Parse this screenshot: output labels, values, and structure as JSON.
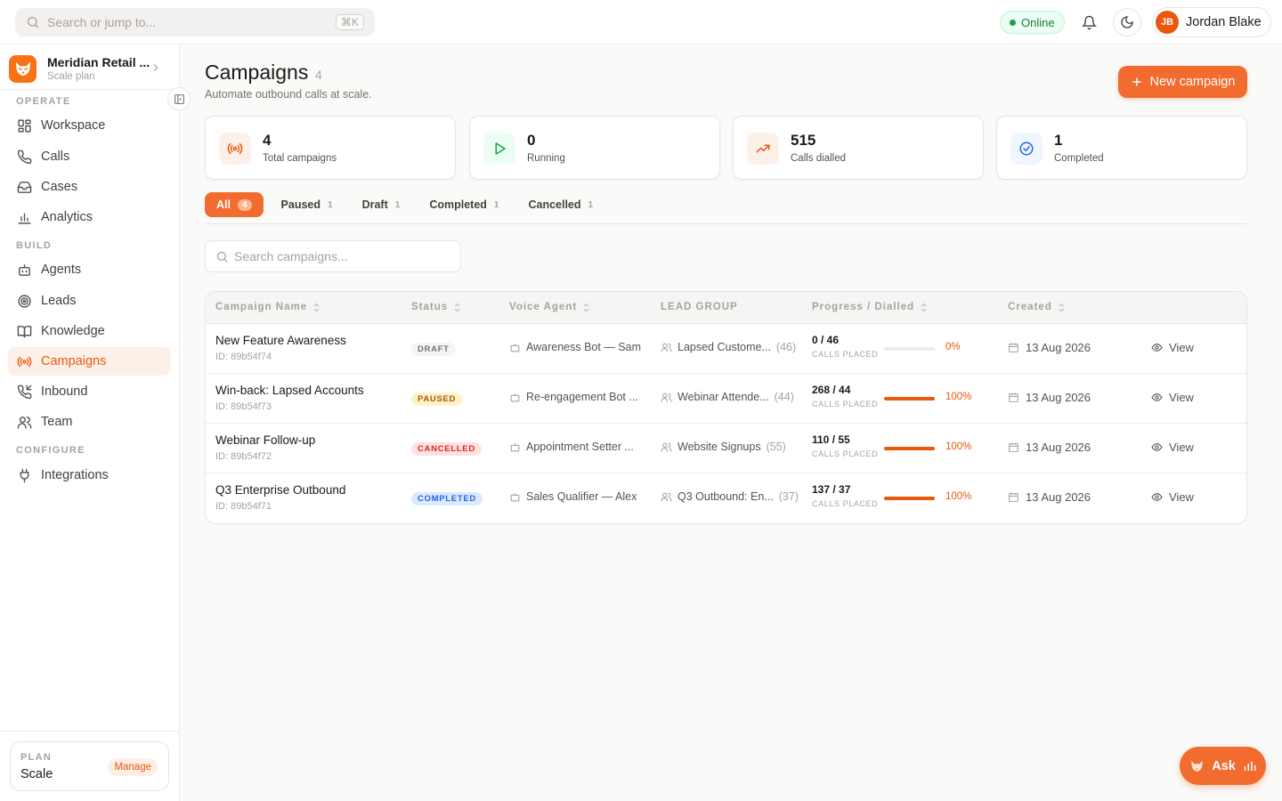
{
  "topbar": {
    "search_placeholder": "Search or jump to...",
    "shortcut": "⌘K",
    "status": "Online",
    "user": {
      "initials": "JB",
      "name": "Jordan Blake"
    }
  },
  "sidebar": {
    "org_name": "Meridian Retail ...",
    "org_plan": "Scale plan",
    "sections": {
      "operate": "OPERATE",
      "build": "BUILD",
      "configure": "CONFIGURE"
    },
    "items": [
      {
        "label": "Workspace",
        "icon": "grid-icon"
      },
      {
        "label": "Calls",
        "icon": "phone-icon"
      },
      {
        "label": "Cases",
        "icon": "inbox-icon"
      },
      {
        "label": "Analytics",
        "icon": "bar-chart-icon"
      },
      {
        "label": "Agents",
        "icon": "bot-icon"
      },
      {
        "label": "Leads",
        "icon": "target-icon"
      },
      {
        "label": "Knowledge",
        "icon": "book-icon"
      },
      {
        "label": "Campaigns",
        "icon": "broadcast-icon",
        "active": true
      },
      {
        "label": "Inbound",
        "icon": "phone-incoming-icon"
      },
      {
        "label": "Team",
        "icon": "users-icon"
      },
      {
        "label": "Integrations",
        "icon": "plug-icon"
      }
    ],
    "plan": {
      "label": "PLAN",
      "value": "Scale",
      "manage": "Manage"
    }
  },
  "page": {
    "title": "Campaigns",
    "count": "4",
    "subtitle": "Automate outbound calls at scale.",
    "new_button": "New campaign"
  },
  "stats": [
    {
      "value": "4",
      "label": "Total campaigns",
      "icon": "broadcast-icon"
    },
    {
      "value": "0",
      "label": "Running",
      "icon": "play-icon"
    },
    {
      "value": "515",
      "label": "Calls dialled",
      "icon": "trending-up-icon"
    },
    {
      "value": "1",
      "label": "Completed",
      "icon": "check-circle-icon"
    }
  ],
  "tabs": [
    {
      "label": "All",
      "count": "4",
      "active": true
    },
    {
      "label": "Paused",
      "count": "1"
    },
    {
      "label": "Draft",
      "count": "1"
    },
    {
      "label": "Completed",
      "count": "1"
    },
    {
      "label": "Cancelled",
      "count": "1"
    }
  ],
  "search": {
    "placeholder": "Search campaigns..."
  },
  "table": {
    "headers": {
      "name": "Campaign Name",
      "status": "Status",
      "agent": "Voice Agent",
      "lead_group": "LEAD GROUP",
      "progress": "Progress / Dialled",
      "created": "Created"
    },
    "progress_caption": "CALLS PLACED",
    "view_label": "View",
    "rows": [
      {
        "name": "New Feature Awareness",
        "id": "ID: 89b54f74",
        "status": "DRAFT",
        "agent": "Awareness Bot — Sam",
        "lead_group": "Lapsed Custome...",
        "lead_count": "(46)",
        "progress": "0 / 46",
        "progress_fraction": 0,
        "percent": "0%",
        "created": "13 Aug 2026"
      },
      {
        "name": "Win-back: Lapsed Accounts",
        "id": "ID: 89b54f73",
        "status": "PAUSED",
        "agent": "Re-engagement Bot ...",
        "lead_group": "Webinar Attende...",
        "lead_count": "(44)",
        "progress": "268 / 44",
        "progress_fraction": 1,
        "percent": "100%",
        "created": "13 Aug 2026"
      },
      {
        "name": "Webinar Follow-up",
        "id": "ID: 89b54f72",
        "status": "CANCELLED",
        "agent": "Appointment Setter ...",
        "lead_group": "Website Signups",
        "lead_count": "(55)",
        "progress": "110 / 55",
        "progress_fraction": 1,
        "percent": "100%",
        "created": "13 Aug 2026"
      },
      {
        "name": "Q3 Enterprise Outbound",
        "id": "ID: 89b54f71",
        "status": "COMPLETED",
        "agent": "Sales Qualifier — Alex",
        "lead_group": "Q3 Outbound: En...",
        "lead_count": "(37)",
        "progress": "137 / 37",
        "progress_fraction": 1,
        "percent": "100%",
        "created": "13 Aug 2026"
      }
    ]
  },
  "ask_button": "Ask",
  "colors": {
    "accent": "#f26b2f",
    "status_draft": "#f5f5f4",
    "status_paused": "#fef3c7",
    "status_cancelled": "#fee2e2",
    "status_completed": "#dbeafe"
  }
}
